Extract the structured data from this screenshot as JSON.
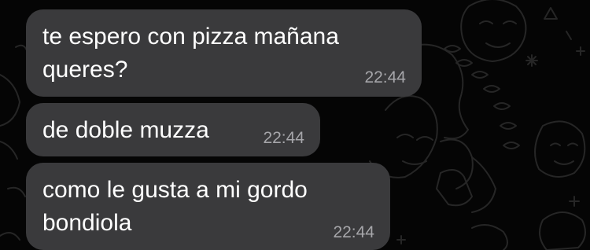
{
  "messages": [
    {
      "text": "te espero con pizza mañana\nqueres?",
      "time": "22:44"
    },
    {
      "text": "de doble muzza",
      "time": "22:44"
    },
    {
      "text": "como le gusta a mi gordo\nbondiola",
      "time": "22:44"
    }
  ],
  "colors": {
    "background": "#050505",
    "bubble": "#3a3a3c",
    "text": "#ffffff",
    "timestamp": "#a6a6aa"
  },
  "icons": [
    "chat-wallpaper-doodle-pattern"
  ]
}
